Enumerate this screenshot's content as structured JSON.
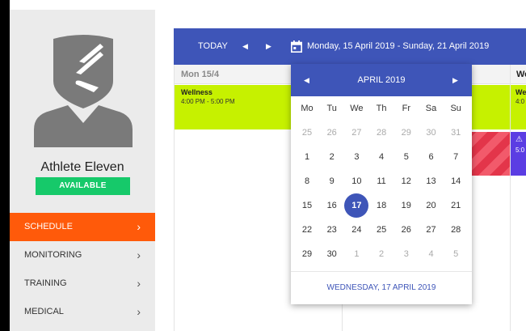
{
  "profile": {
    "name": "Athlete Eleven",
    "status": "AVAILABLE"
  },
  "nav": {
    "items": [
      {
        "label": "SCHEDULE",
        "active": true
      },
      {
        "label": "MONITORING",
        "active": false
      },
      {
        "label": "TRAINING",
        "active": false
      },
      {
        "label": "MEDICAL",
        "active": false
      }
    ]
  },
  "toolbar": {
    "today_label": "TODAY",
    "date_range": "Monday, 15 April 2019 - Sunday, 21 April 2019"
  },
  "calendar": {
    "col1_header": "Mon 15/4",
    "col4_header": "We",
    "event1": {
      "title": "Wellness",
      "time": "4:00 PM - 5:00 PM"
    },
    "event2_title": "We",
    "event2_time": "4:0",
    "purple_time": "5:0"
  },
  "datepicker": {
    "month_label": "APRIL 2019",
    "weekdays": [
      "Mo",
      "Tu",
      "We",
      "Th",
      "Fr",
      "Sa",
      "Su"
    ],
    "weeks": [
      [
        {
          "d": "25",
          "m": true
        },
        {
          "d": "26",
          "m": true
        },
        {
          "d": "27",
          "m": true
        },
        {
          "d": "28",
          "m": true
        },
        {
          "d": "29",
          "m": true
        },
        {
          "d": "30",
          "m": true
        },
        {
          "d": "31",
          "m": true
        }
      ],
      [
        {
          "d": "1"
        },
        {
          "d": "2"
        },
        {
          "d": "3"
        },
        {
          "d": "4"
        },
        {
          "d": "5"
        },
        {
          "d": "6"
        },
        {
          "d": "7"
        }
      ],
      [
        {
          "d": "8"
        },
        {
          "d": "9"
        },
        {
          "d": "10"
        },
        {
          "d": "11"
        },
        {
          "d": "12"
        },
        {
          "d": "13"
        },
        {
          "d": "14"
        }
      ],
      [
        {
          "d": "15"
        },
        {
          "d": "16"
        },
        {
          "d": "17",
          "s": true
        },
        {
          "d": "18"
        },
        {
          "d": "19"
        },
        {
          "d": "20"
        },
        {
          "d": "21"
        }
      ],
      [
        {
          "d": "22"
        },
        {
          "d": "23"
        },
        {
          "d": "24"
        },
        {
          "d": "25"
        },
        {
          "d": "26"
        },
        {
          "d": "27"
        },
        {
          "d": "28"
        }
      ],
      [
        {
          "d": "29"
        },
        {
          "d": "30"
        },
        {
          "d": "1",
          "m": true
        },
        {
          "d": "2",
          "m": true
        },
        {
          "d": "3",
          "m": true
        },
        {
          "d": "4",
          "m": true
        },
        {
          "d": "5",
          "m": true
        }
      ]
    ],
    "footer_label": "WEDNESDAY, 17 APRIL 2019"
  },
  "colors": {
    "accent": "#3e55b8",
    "active_nav": "#ff5a0a",
    "status_green": "#16c96a",
    "event_green": "#c6f100",
    "event_red": "#e3354a",
    "event_purple": "#5b3de3"
  }
}
